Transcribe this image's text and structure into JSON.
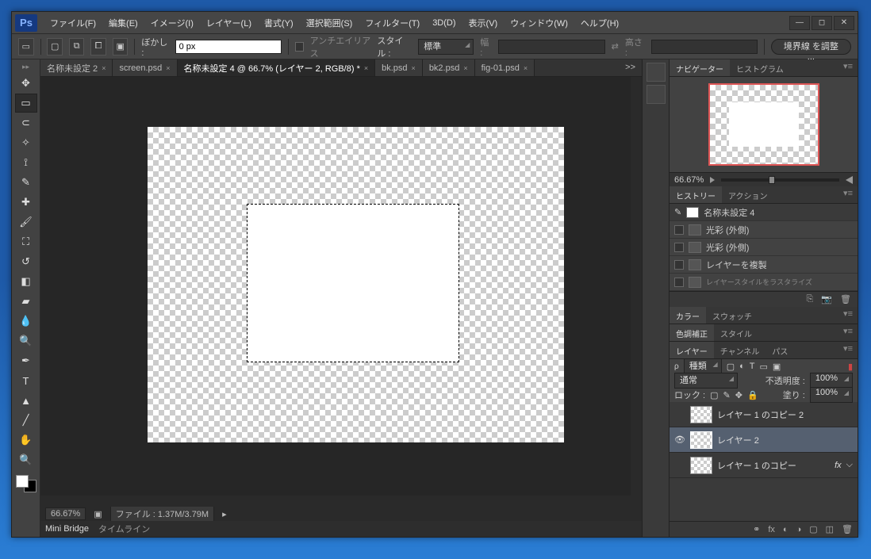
{
  "menubar": {
    "items": [
      "ファイル(F)",
      "編集(E)",
      "イメージ(I)",
      "レイヤー(L)",
      "書式(Y)",
      "選択範囲(S)",
      "フィルター(T)",
      "3D(D)",
      "表示(V)",
      "ウィンドウ(W)",
      "ヘルプ(H)"
    ]
  },
  "options": {
    "blur_label": "ぼかし :",
    "blur_value": "0 px",
    "antialias": "アンチエイリアス",
    "style_label": "スタイル :",
    "style_value": "標準",
    "width_label": "幅 :",
    "height_label": "高さ :",
    "refine": "境界線 を調整 ..."
  },
  "tabs": [
    {
      "label": "名称未設定 2",
      "close": "×"
    },
    {
      "label": "screen.psd",
      "close": "×"
    },
    {
      "label": "名称未設定 4 @ 66.7% (レイヤー 2, RGB/8) *",
      "close": "×",
      "active": true
    },
    {
      "label": "bk.psd",
      "close": "×"
    },
    {
      "label": "bk2.psd",
      "close": "×"
    },
    {
      "label": "fig-01.psd",
      "close": "×"
    }
  ],
  "tabs_more": ">>",
  "status": {
    "zoom": "66.67%",
    "fileinfo": "ファイル : 1.37M/3.79M"
  },
  "bottom_tabs": {
    "a": "Mini Bridge",
    "b": "タイムライン"
  },
  "panels": {
    "nav": {
      "tab1": "ナビゲーター",
      "tab2": "ヒストグラム",
      "zoom": "66.67%"
    },
    "history": {
      "tab1": "ヒストリー",
      "tab2": "アクション",
      "doc": "名称未設定 4",
      "items": [
        "光彩 (外側)",
        "光彩 (外側)",
        "レイヤーを複製",
        "レイヤースタイルをラスタライズ"
      ]
    },
    "color": {
      "tab1": "カラー",
      "tab2": "スウォッチ"
    },
    "adjust": {
      "tab1": "色調補正",
      "tab2": "スタイル"
    },
    "layers": {
      "tab1": "レイヤー",
      "tab2": "チャンネル",
      "tab3": "パス",
      "kind": "種類",
      "blend": "通常",
      "opacity_label": "不透明度 :",
      "opacity": "100%",
      "lock_label": "ロック :",
      "fill_label": "塗り :",
      "fill": "100%",
      "items": [
        {
          "name": "レイヤー 1 のコピー 2",
          "eye": ""
        },
        {
          "name": "レイヤー 2",
          "eye": "👁",
          "sel": true
        },
        {
          "name": "レイヤー 1 のコピー",
          "eye": "",
          "fx": "fx"
        }
      ]
    }
  }
}
